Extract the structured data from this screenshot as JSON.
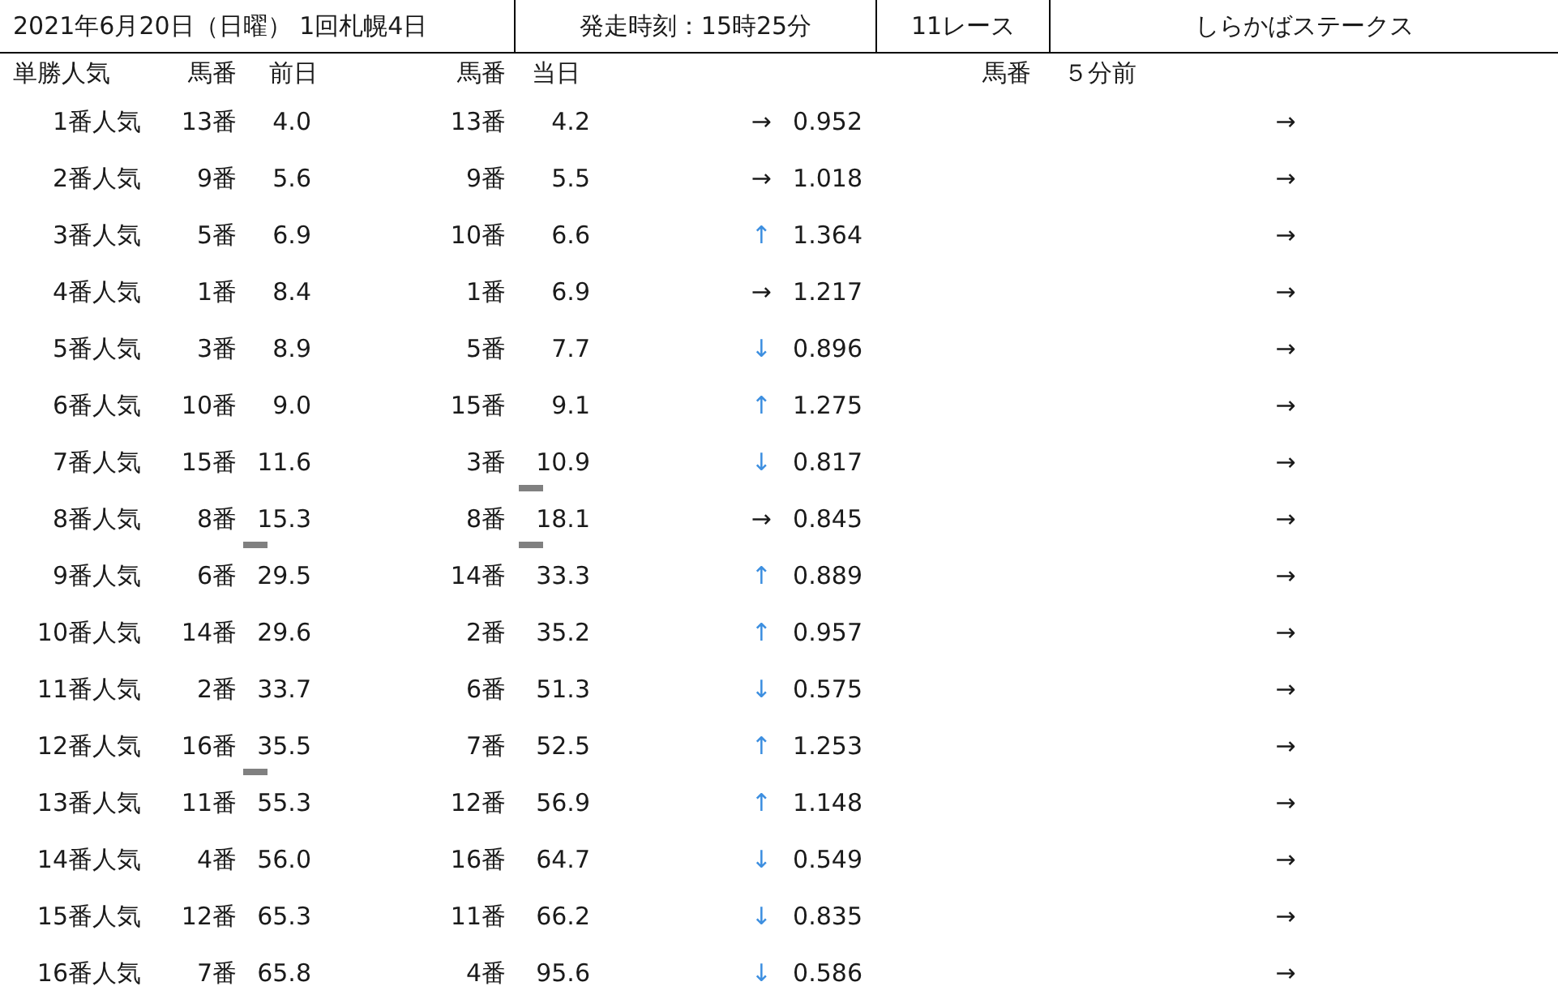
{
  "title_bar": {
    "date_meeting": "2021年6月20日（日曜） 1回札幌4日",
    "post_time": "発走時刻：15時25分",
    "race_number": "11レース",
    "race_name": "しらかばステークス"
  },
  "columns": [
    "単勝人気",
    "馬番",
    "前日",
    "馬番",
    "当日",
    "馬番",
    "５分前"
  ],
  "rows": [
    {
      "rank": "1番人気",
      "prev_no": "13番",
      "prev_odds": "4.0",
      "prev_marked": false,
      "today_no": "13番",
      "today_odds": "4.2",
      "today_marked": false,
      "trend": "→",
      "color": "#1a1a1a",
      "ratio": "0.952",
      "five_min_trend": "→"
    },
    {
      "rank": "2番人気",
      "prev_no": "9番",
      "prev_odds": "5.6",
      "prev_marked": false,
      "today_no": "9番",
      "today_odds": "5.5",
      "today_marked": false,
      "trend": "→",
      "color": "#1a1a1a",
      "ratio": "1.018",
      "five_min_trend": "→"
    },
    {
      "rank": "3番人気",
      "prev_no": "5番",
      "prev_odds": "6.9",
      "prev_marked": false,
      "today_no": "10番",
      "today_odds": "6.6",
      "today_marked": false,
      "trend": "↑",
      "color": "#3d8fe0",
      "ratio": "1.364",
      "five_min_trend": "→"
    },
    {
      "rank": "4番人気",
      "prev_no": "1番",
      "prev_odds": "8.4",
      "prev_marked": false,
      "today_no": "1番",
      "today_odds": "6.9",
      "today_marked": false,
      "trend": "→",
      "color": "#1a1a1a",
      "ratio": "1.217",
      "five_min_trend": "→"
    },
    {
      "rank": "5番人気",
      "prev_no": "3番",
      "prev_odds": "8.9",
      "prev_marked": false,
      "today_no": "5番",
      "today_odds": "7.7",
      "today_marked": false,
      "trend": "↓",
      "color": "#3d8fe0",
      "ratio": "0.896",
      "five_min_trend": "→"
    },
    {
      "rank": "6番人気",
      "prev_no": "10番",
      "prev_odds": "9.0",
      "prev_marked": false,
      "today_no": "15番",
      "today_odds": "9.1",
      "today_marked": false,
      "trend": "↑",
      "color": "#3d8fe0",
      "ratio": "1.275",
      "five_min_trend": "→"
    },
    {
      "rank": "7番人気",
      "prev_no": "15番",
      "prev_odds": "11.6",
      "prev_marked": false,
      "today_no": "3番",
      "today_odds": "10.9",
      "today_marked": true,
      "trend": "↓",
      "color": "#3d8fe0",
      "ratio": "0.817",
      "five_min_trend": "→"
    },
    {
      "rank": "8番人気",
      "prev_no": "8番",
      "prev_odds": "15.3",
      "prev_marked": true,
      "today_no": "8番",
      "today_odds": "18.1",
      "today_marked": true,
      "trend": "→",
      "color": "#1a1a1a",
      "ratio": "0.845",
      "five_min_trend": "→"
    },
    {
      "rank": "9番人気",
      "prev_no": "6番",
      "prev_odds": "29.5",
      "prev_marked": false,
      "today_no": "14番",
      "today_odds": "33.3",
      "today_marked": false,
      "trend": "↑",
      "color": "#3d8fe0",
      "ratio": "0.889",
      "five_min_trend": "→"
    },
    {
      "rank": "10番人気",
      "prev_no": "14番",
      "prev_odds": "29.6",
      "prev_marked": false,
      "today_no": "2番",
      "today_odds": "35.2",
      "today_marked": false,
      "trend": "↑",
      "color": "#3d8fe0",
      "ratio": "0.957",
      "five_min_trend": "→"
    },
    {
      "rank": "11番人気",
      "prev_no": "2番",
      "prev_odds": "33.7",
      "prev_marked": false,
      "today_no": "6番",
      "today_odds": "51.3",
      "today_marked": false,
      "trend": "↓",
      "color": "#3d8fe0",
      "ratio": "0.575",
      "five_min_trend": "→"
    },
    {
      "rank": "12番人気",
      "prev_no": "16番",
      "prev_odds": "35.5",
      "prev_marked": true,
      "today_no": "7番",
      "today_odds": "52.5",
      "today_marked": false,
      "trend": "↑",
      "color": "#3d8fe0",
      "ratio": "1.253",
      "five_min_trend": "→"
    },
    {
      "rank": "13番人気",
      "prev_no": "11番",
      "prev_odds": "55.3",
      "prev_marked": false,
      "today_no": "12番",
      "today_odds": "56.9",
      "today_marked": false,
      "trend": "↑",
      "color": "#3d8fe0",
      "ratio": "1.148",
      "five_min_trend": "→"
    },
    {
      "rank": "14番人気",
      "prev_no": "4番",
      "prev_odds": "56.0",
      "prev_marked": false,
      "today_no": "16番",
      "today_odds": "64.7",
      "today_marked": false,
      "trend": "↓",
      "color": "#3d8fe0",
      "ratio": "0.549",
      "five_min_trend": "→"
    },
    {
      "rank": "15番人気",
      "prev_no": "12番",
      "prev_odds": "65.3",
      "prev_marked": false,
      "today_no": "11番",
      "today_odds": "66.2",
      "today_marked": false,
      "trend": "↓",
      "color": "#3d8fe0",
      "ratio": "0.835",
      "five_min_trend": "→"
    },
    {
      "rank": "16番人気",
      "prev_no": "7番",
      "prev_odds": "65.8",
      "prev_marked": false,
      "today_no": "4番",
      "today_odds": "95.6",
      "today_marked": false,
      "trend": "↓",
      "color": "#3d8fe0",
      "ratio": "0.586",
      "five_min_trend": "→"
    }
  ]
}
